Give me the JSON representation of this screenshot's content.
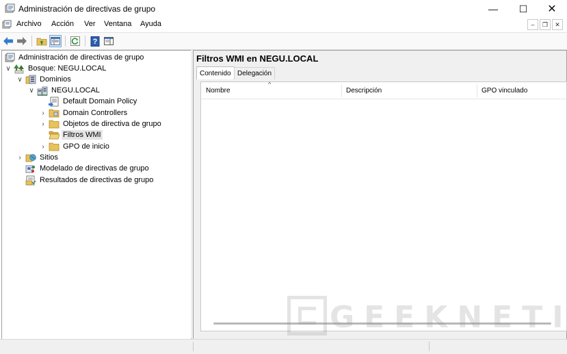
{
  "window": {
    "title": "Administración de directivas de grupo",
    "minimize": "—",
    "maximize": "☐",
    "close": "✕"
  },
  "menubar": {
    "items": [
      "Archivo",
      "Acción",
      "Ver",
      "Ventana",
      "Ayuda"
    ],
    "mdi_min": "–",
    "mdi_restore": "❐",
    "mdi_close": "✕"
  },
  "toolbar": {
    "help_label": "?"
  },
  "tree": {
    "root": "Administración de directivas de grupo",
    "forest": "Bosque: NEGU.LOCAL",
    "domains": "Dominios",
    "domain": "NEGU.LOCAL",
    "default_policy": "Default Domain Policy",
    "domain_controllers": "Domain Controllers",
    "gpo_objects": "Objetos de directiva de grupo",
    "wmi_filters": "Filtros WMI",
    "starter_gpos": "GPO de inicio",
    "sites": "Sitios",
    "modeling": "Modelado de directivas de grupo",
    "results": "Resultados de directivas de grupo",
    "expanded_glyph": "∨",
    "collapsed_glyph": "›"
  },
  "result": {
    "title": "Filtros WMI en NEGU.LOCAL",
    "tabs": [
      "Contenido",
      "Delegación"
    ],
    "columns": [
      "Nombre",
      "Descripción",
      "GPO vinculado"
    ],
    "sort_glyph": "^"
  },
  "watermark": {
    "text": "GEEKNETIC"
  },
  "colors": {
    "selection": "#e5e5e5",
    "folder": "#e8c25a",
    "nav_arrow": "#2f7bd1",
    "pane_border": "#a0a0a0"
  }
}
